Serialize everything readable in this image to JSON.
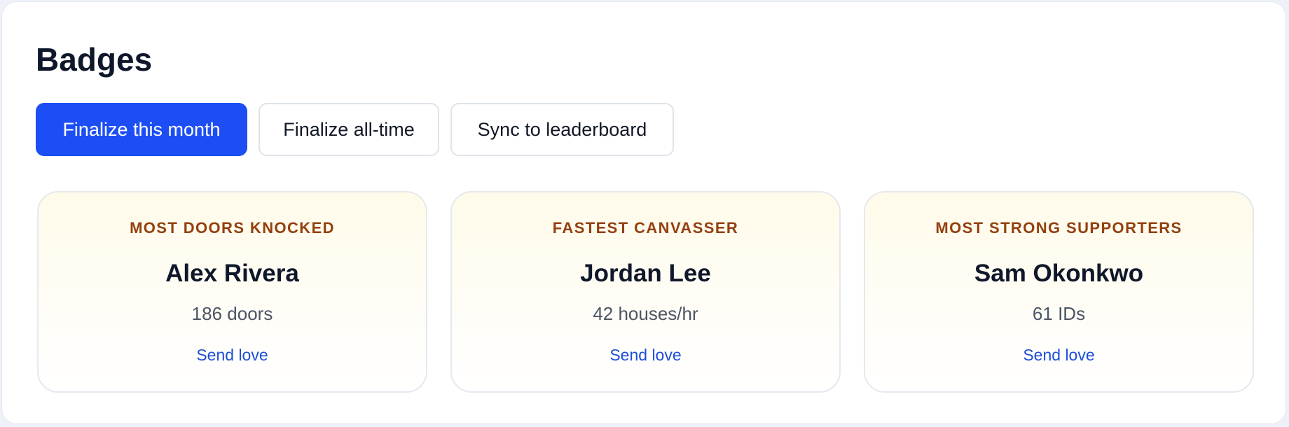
{
  "page": {
    "title": "Badges"
  },
  "actions": {
    "finalize_month": "Finalize this month",
    "finalize_all_time": "Finalize all-time",
    "sync_leaderboard": "Sync to leaderboard"
  },
  "badges": [
    {
      "category": "MOST DOORS KNOCKED",
      "name": "Alex Rivera",
      "stat": "186 doors",
      "action": "Send love"
    },
    {
      "category": "FASTEST CANVASSER",
      "name": "Jordan Lee",
      "stat": "42 houses/hr",
      "action": "Send love"
    },
    {
      "category": "MOST STRONG SUPPORTERS",
      "name": "Sam Okonkwo",
      "stat": "61 IDs",
      "action": "Send love"
    }
  ],
  "colors": {
    "primary": "#1d4ef5",
    "badge_category": "#94400f",
    "link": "#1d4ed8",
    "title": "#0f172a"
  }
}
